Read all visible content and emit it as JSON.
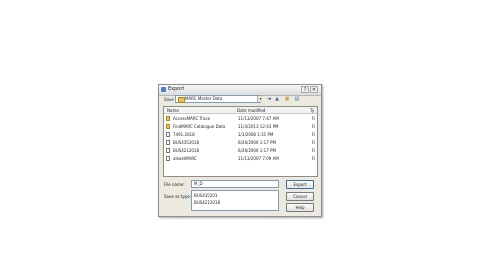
{
  "dialog": {
    "title": "Export",
    "help_glyph": "?",
    "close_glyph": "✕"
  },
  "lookin": {
    "label": "Save in:",
    "value": "MARC Master Data"
  },
  "toolbar": {
    "back_glyph": "◄",
    "up_glyph": "▲",
    "newfolder_glyph": "▣",
    "views_glyph": "▤",
    "dropdown_glyph": "▾"
  },
  "columns": {
    "name": "Name",
    "date": "Date modified",
    "type": "Ty"
  },
  "files": [
    {
      "name": "AccessMARC Trace",
      "date": "11/13/2007 7:47 AM",
      "type": "Fi",
      "icon": "folder-icon"
    },
    {
      "name": "FindMARC Catalogue Data",
      "date": "11/3/2013 12:43 PM",
      "type": "Fi",
      "icon": "folder-icon"
    },
    {
      "name": "7491.2018",
      "date": "1/1/2008 1:31 PM",
      "type": "Fi",
      "icon": "document-icon"
    },
    {
      "name": "BUS4352018",
      "date": "6/26/2006 1:17 PM",
      "type": "Fi",
      "icon": "document-icon"
    },
    {
      "name": "BUS4212018",
      "date": "6/26/2006 1:17 PM",
      "type": "Fi",
      "icon": "document-icon"
    },
    {
      "name": "aleastMARC",
      "date": "11/13/2007 7:09 AM",
      "type": "Fi",
      "icon": "document-icon"
    }
  ],
  "filename": {
    "label": "File name:",
    "value": "M_D"
  },
  "saveas": {
    "label": "Save as type:",
    "options": [
      "BUS435201",
      "BUS4212018"
    ]
  },
  "buttons": {
    "export": "Export",
    "cancel": "Cancel",
    "help": "Help"
  }
}
